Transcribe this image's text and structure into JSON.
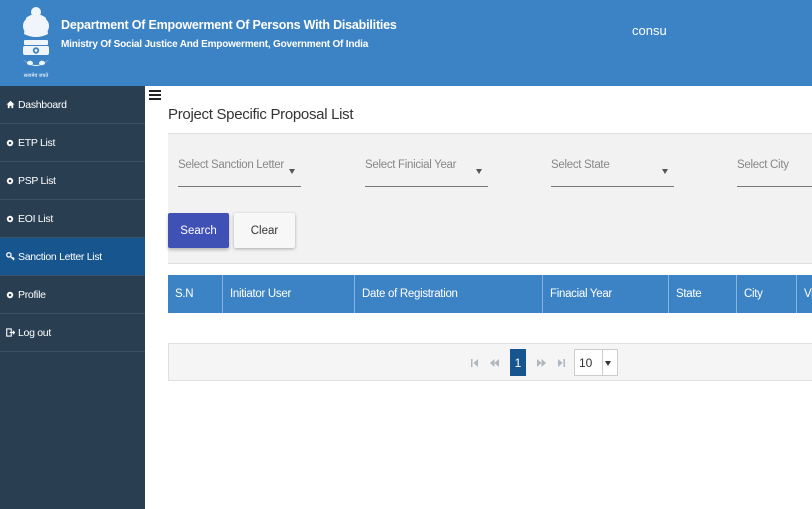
{
  "header": {
    "department": "Department Of Empowerment Of Persons With Disabilities",
    "ministry": "Ministry Of Social Justice And Empowerment, Government Of India",
    "user": "consu",
    "emblem_caption": "सत्यमेव जयते",
    "background_color": "#3c83c6"
  },
  "sidebar": {
    "items": [
      {
        "label": "Dashboard",
        "icon": "home-icon",
        "active": false
      },
      {
        "label": "ETP List",
        "icon": "circle-icon",
        "active": false
      },
      {
        "label": "PSP List",
        "icon": "circle-icon",
        "active": false
      },
      {
        "label": "EOI List",
        "icon": "circle-icon",
        "active": false
      },
      {
        "label": "Sanction Letter List",
        "icon": "key-icon",
        "active": true
      },
      {
        "label": "Profile",
        "icon": "circle-icon",
        "active": false
      },
      {
        "label": "Log out",
        "icon": "logout-icon",
        "active": false
      }
    ],
    "background_color": "#2a3e52",
    "active_color": "#17558f"
  },
  "main": {
    "title": "Project Specific Proposal List",
    "filters": {
      "sanction_letter": "Select Sanction Letter",
      "financial_year": "Select Finicial Year",
      "state": "Select State",
      "city": "Select City"
    },
    "search_label": "Search",
    "clear_label": "Clear",
    "table": {
      "columns": [
        "S.N",
        "Initiator User",
        "Date of Registration",
        "Finacial Year",
        "State",
        "City",
        "Vi"
      ]
    },
    "pagination": {
      "current_page": "1",
      "page_size": "10"
    }
  }
}
